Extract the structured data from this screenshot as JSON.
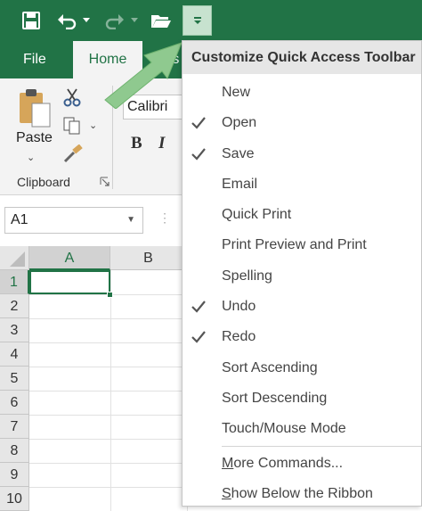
{
  "ribbon": {
    "tabs": {
      "file": "File",
      "home": "Home",
      "insert": "Ins"
    },
    "clipboard": {
      "paste": "Paste",
      "group_label": "Clipboard"
    },
    "font": {
      "name": "Calibri",
      "bold": "B",
      "italic": "I"
    }
  },
  "namebox": {
    "value": "A1"
  },
  "grid": {
    "columns": [
      "A",
      "B"
    ],
    "rows": [
      "1",
      "2",
      "3",
      "4",
      "5",
      "6",
      "7",
      "8",
      "9",
      "10"
    ]
  },
  "menu": {
    "title": "Customize Quick Access Toolbar",
    "items": [
      {
        "label": "New",
        "checked": false
      },
      {
        "label": "Open",
        "checked": true
      },
      {
        "label": "Save",
        "checked": true
      },
      {
        "label": "Email",
        "checked": false
      },
      {
        "label": "Quick Print",
        "checked": false
      },
      {
        "label": "Print Preview and Print",
        "checked": false
      },
      {
        "label": "Spelling",
        "checked": false
      },
      {
        "label": "Undo",
        "checked": true
      },
      {
        "label": "Redo",
        "checked": true
      },
      {
        "label": "Sort Ascending",
        "checked": false
      },
      {
        "label": "Sort Descending",
        "checked": false
      },
      {
        "label": "Touch/Mouse Mode",
        "checked": false
      }
    ],
    "more_commands": {
      "underlined": "M",
      "rest": "ore Commands..."
    },
    "show_below": {
      "underlined": "S",
      "rest": "how Below the Ribbon"
    }
  },
  "icons": {
    "save": "save-icon",
    "undo": "undo-icon",
    "redo": "redo-icon",
    "open": "folder-open-icon",
    "customize": "customize-toolbar-dropdown-icon",
    "check": "checkmark-icon",
    "cut": "scissors-icon",
    "copy": "copy-icon",
    "format_painter": "format-painter-icon"
  },
  "colors": {
    "excel_green": "#217346",
    "menu_highlight": "#c7e2cf",
    "callout_arrow": "#8fc98f"
  }
}
